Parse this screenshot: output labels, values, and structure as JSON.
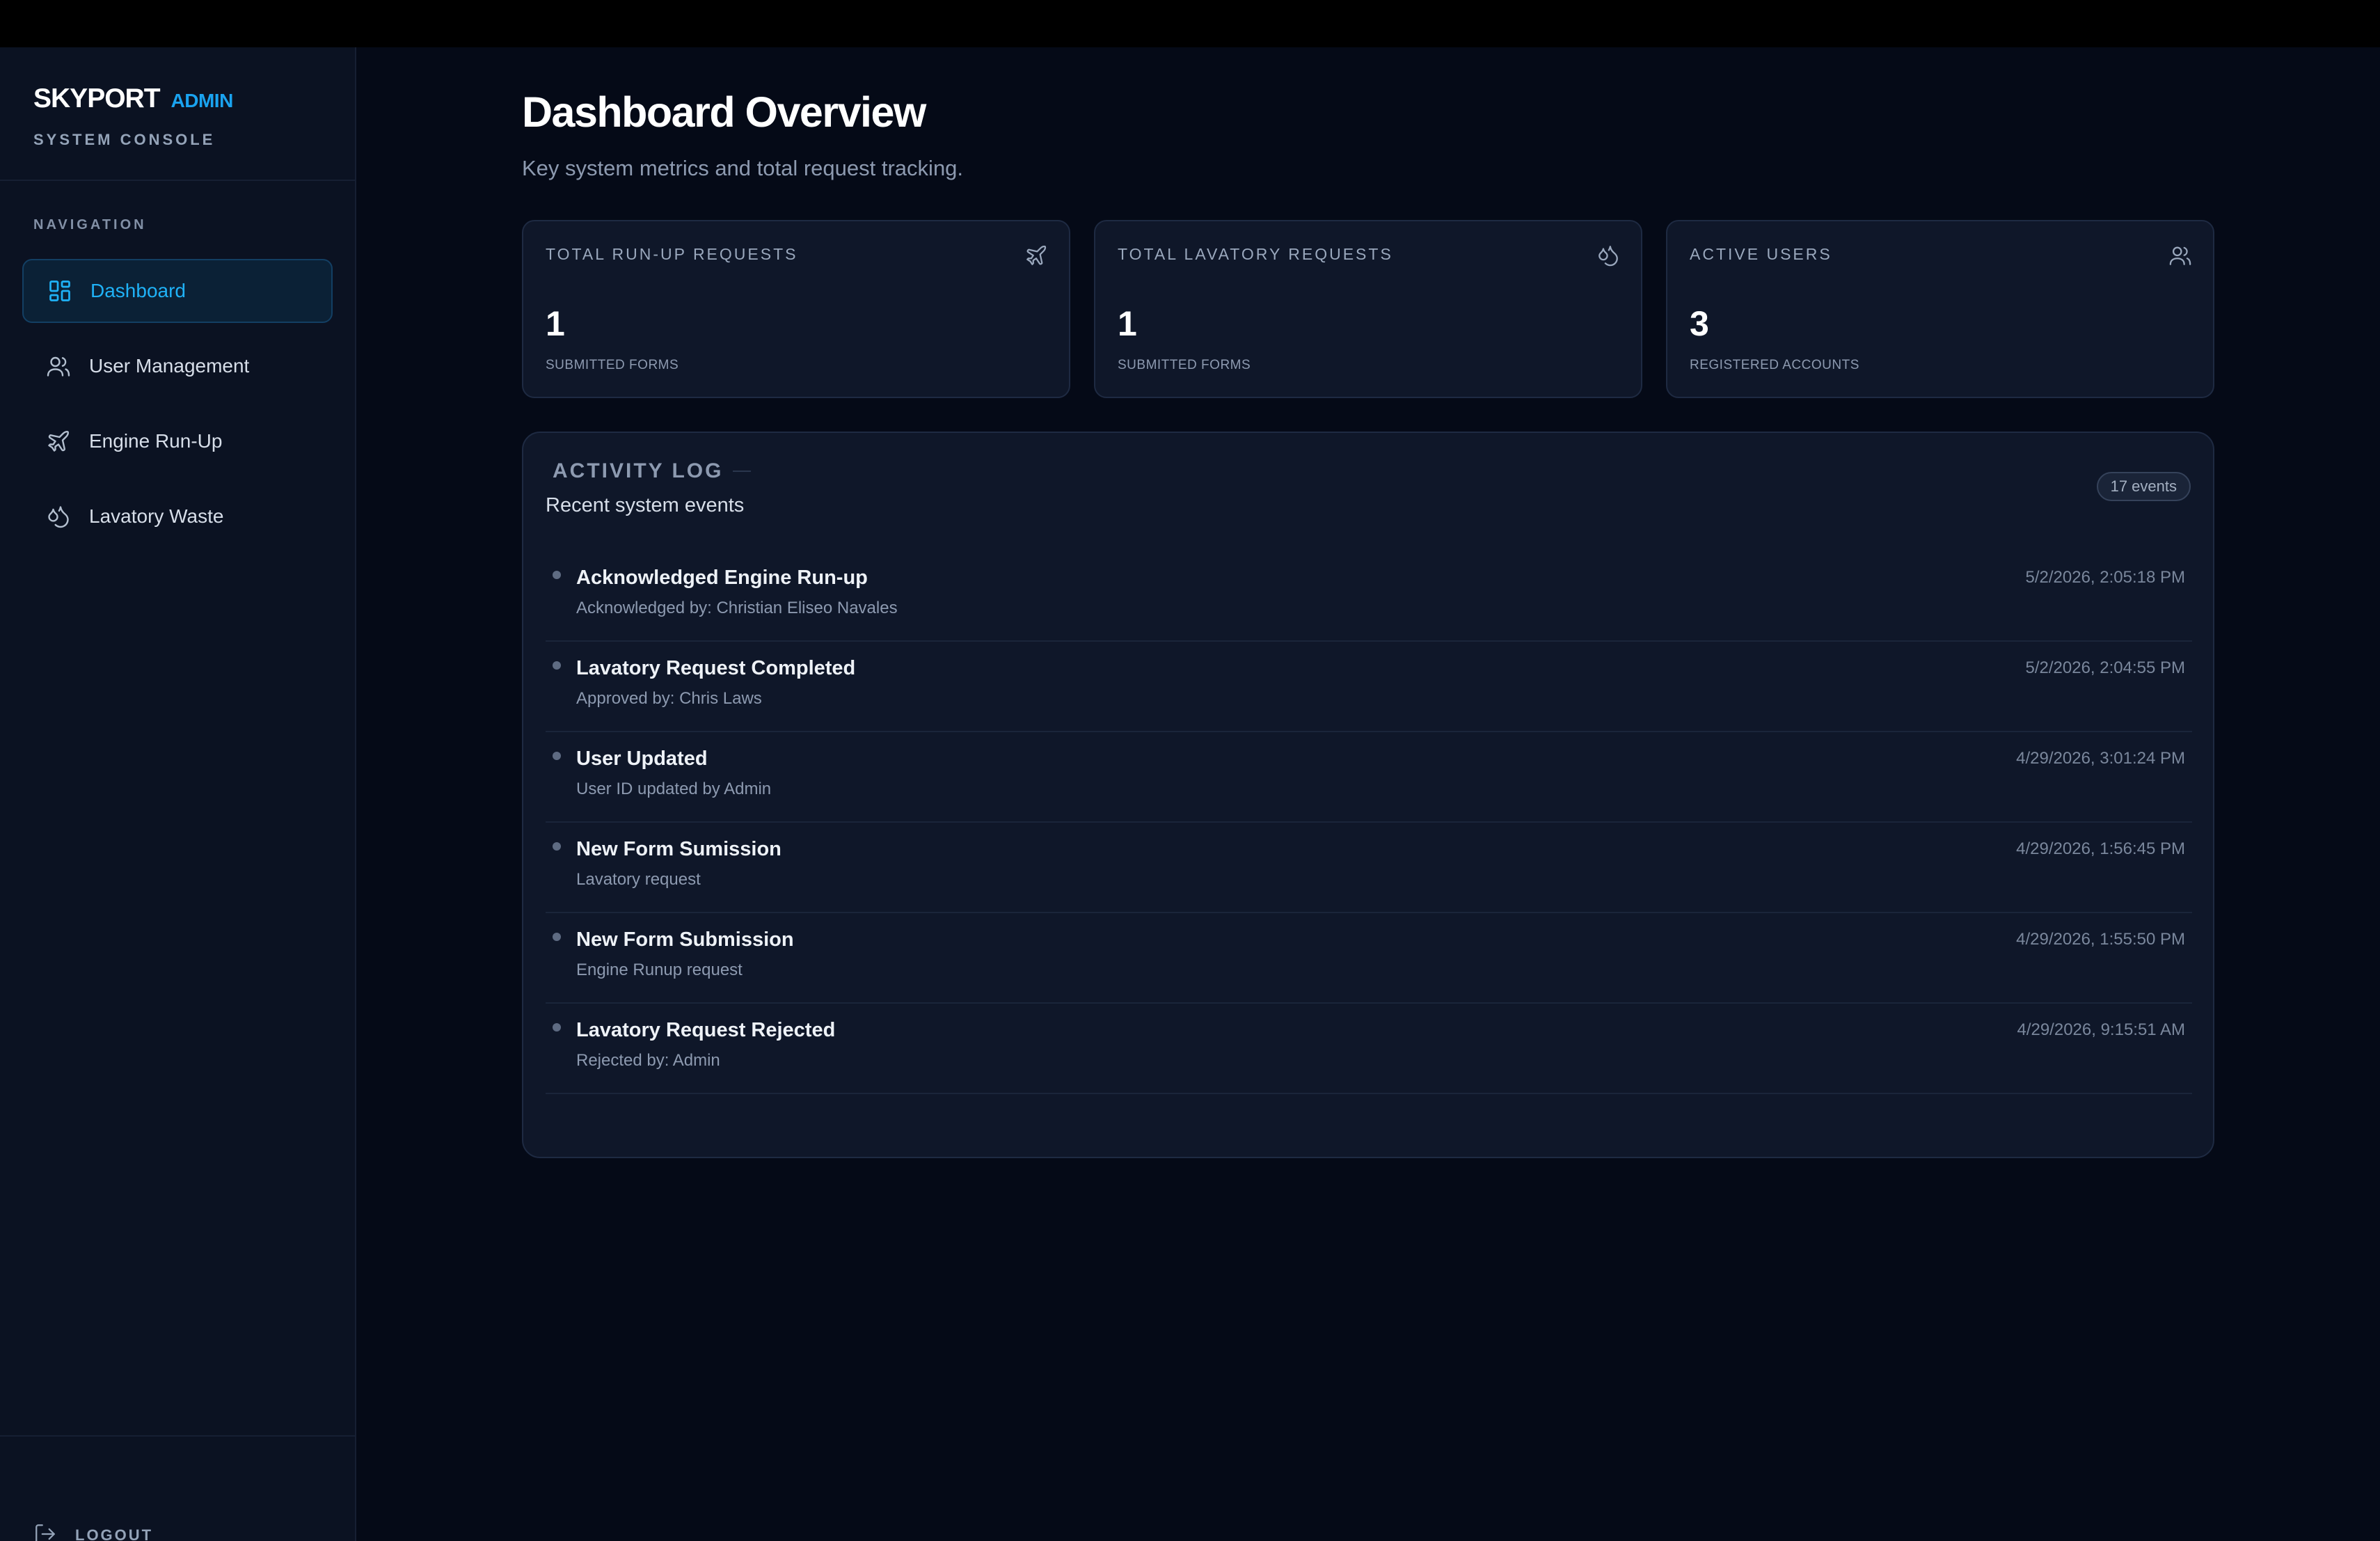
{
  "brand": {
    "name": "SKYPORT",
    "tag": "ADMIN",
    "subtitle": "SYSTEM CONSOLE"
  },
  "nav": {
    "heading": "NAVIGATION",
    "items": [
      {
        "label": "Dashboard",
        "icon": "dashboard-icon",
        "active": true
      },
      {
        "label": "User Management",
        "icon": "users-icon"
      },
      {
        "label": "Engine Run-Up",
        "icon": "plane-icon"
      },
      {
        "label": "Lavatory Waste",
        "icon": "droplets-icon"
      }
    ],
    "logout_label": "LOGOUT"
  },
  "page": {
    "title": "Dashboard Overview",
    "subtitle": "Key system metrics and total request tracking."
  },
  "stats": [
    {
      "label": "TOTAL RUN-UP REQUESTS",
      "value": "1",
      "caption": "SUBMITTED FORMS",
      "icon": "plane-icon"
    },
    {
      "label": "TOTAL LAVATORY REQUESTS",
      "value": "1",
      "caption": "SUBMITTED FORMS",
      "icon": "droplets-icon"
    },
    {
      "label": "ACTIVE USERS",
      "value": "3",
      "caption": "REGISTERED ACCOUNTS",
      "icon": "users-icon"
    }
  ],
  "activity": {
    "title": "ACTIVITY LOG",
    "subtitle": "Recent system events",
    "badge": "17 events",
    "events": [
      {
        "title": "Acknowledged Engine Run-up",
        "detail": "Acknowledged by: Christian Eliseo Navales",
        "time": "5/2/2026, 2:05:18 PM"
      },
      {
        "title": "Lavatory Request Completed",
        "detail": "Approved by: Chris Laws",
        "time": "5/2/2026, 2:04:55 PM"
      },
      {
        "title": "User Updated",
        "detail": "User ID updated by Admin",
        "time": "4/29/2026, 3:01:24 PM"
      },
      {
        "title": "New Form Sumission",
        "detail": "Lavatory request",
        "time": "4/29/2026, 1:56:45 PM"
      },
      {
        "title": "New Form Submission",
        "detail": "Engine Runup request",
        "time": "4/29/2026, 1:55:50 PM"
      },
      {
        "title": "Lavatory Request Rejected",
        "detail": "Rejected by: Admin",
        "time": "4/29/2026, 9:15:51 AM"
      }
    ]
  },
  "colors": {
    "accent": "#1fb2f7",
    "background": "#050a17",
    "sidebar": "#0b1222",
    "card": "#0f1729"
  }
}
